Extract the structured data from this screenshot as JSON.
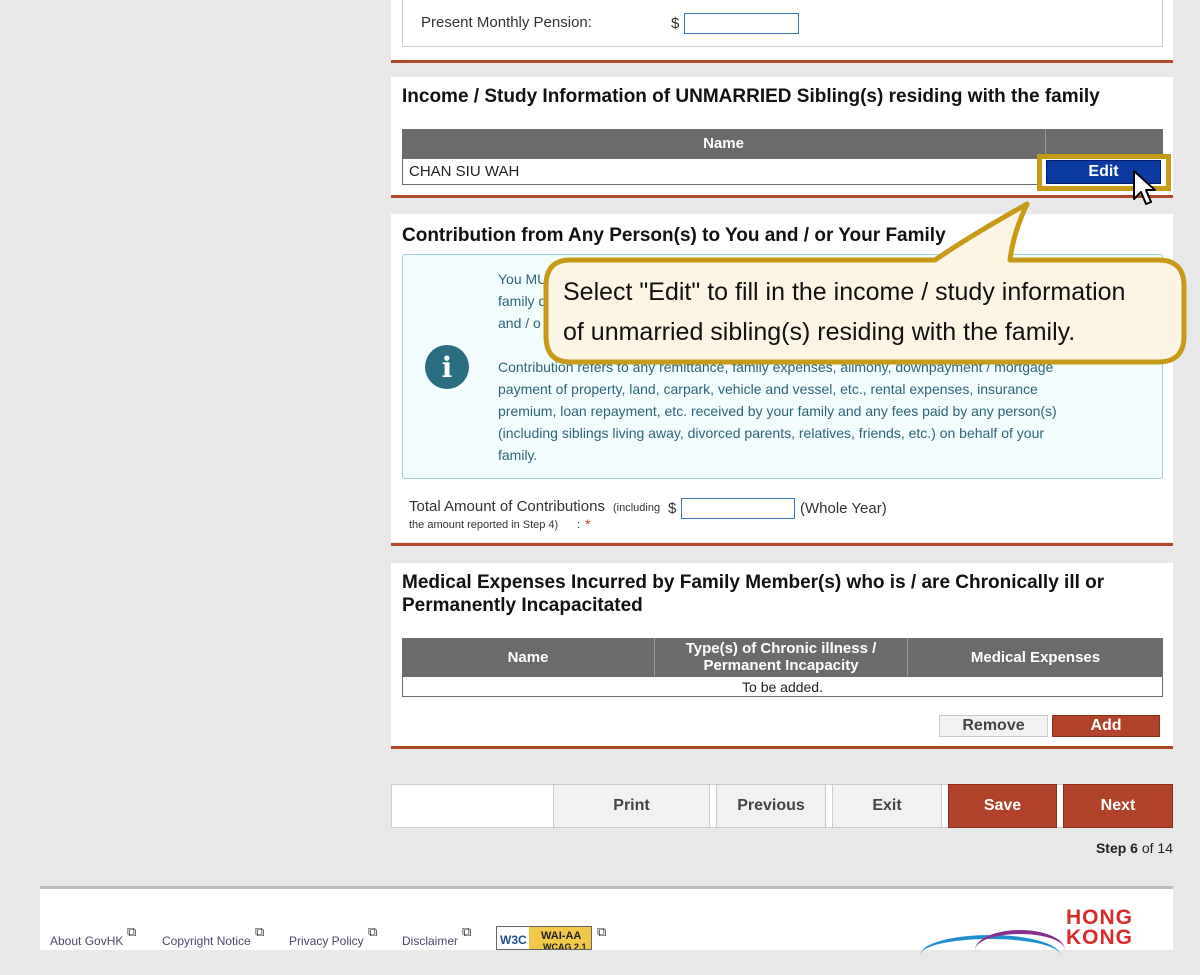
{
  "pension": {
    "label": "Present Monthly Pension:",
    "currency": "$",
    "value": ""
  },
  "siblings": {
    "title": "Income / Study Information of UNMARRIED Sibling(s) residing with the family",
    "col_name": "Name",
    "rows": [
      {
        "name": "CHAN SIU WAH",
        "action": "Edit"
      }
    ]
  },
  "callout": {
    "text_line1": "Select \"Edit\" to fill in the income / study information",
    "text_line2": "of unmarried sibling(s) residing with the family."
  },
  "contribution": {
    "title": "Contribution from Any Person(s) to You and / or Your Family",
    "info_line1": "You MU",
    "info_line2": "family d",
    "info_line3": "and / o",
    "info_para2_line1": "Contribution refers to any remittance, family expenses, alimony, downpayment / mortgage",
    "info_para2_line2": "payment of property, land, carpark, vehicle and vessel, etc., rental expenses, insurance",
    "info_para2_line3": "premium, loan repayment, etc. received by your family and any fees paid by any person(s)",
    "info_para2_line4": "(including siblings living away, divorced parents, relatives, friends, etc.) on behalf of your",
    "info_para2_line5": "family.",
    "total_label": "Total Amount of Contributions",
    "total_note_a": "(including",
    "total_note_b": "the amount reported in Step 4)",
    "total_colon": ":",
    "required_mark": "*",
    "currency": "$",
    "value": "",
    "period": "(Whole Year)"
  },
  "medical": {
    "title_line1": "Medical Expenses Incurred by Family Member(s) who is / are Chronically ill or",
    "title_line2": "Permanently Incapacitated",
    "col_name": "Name",
    "col_type_line1": "Type(s) of Chronic illness /",
    "col_type_line2": "Permanent Incapacity",
    "col_expenses": "Medical Expenses",
    "empty_text": "To be added.",
    "remove_label": "Remove",
    "add_label": "Add"
  },
  "nav": {
    "print_label": "Print",
    "previous_label": "Previous",
    "exit_label": "Exit",
    "save_label": "Save",
    "next_label": "Next",
    "step_prefix": "Step",
    "step_current": "6",
    "step_of": "of 14"
  },
  "footer": {
    "links": [
      "About GovHK",
      "Copyright Notice",
      "Privacy Policy",
      "Disclaimer"
    ],
    "badge_w3c": "W3C",
    "badge_wai": "WAI-AA",
    "badge_wcag": "WCAG 2.1",
    "brand_line1": "HONG",
    "brand_line2": "KONG"
  },
  "colors": {
    "accent_red": "#b0432a",
    "edit_blue": "#0b3aa3",
    "highlight_gold": "#c79a17",
    "info_teal": "#2b6e84"
  }
}
